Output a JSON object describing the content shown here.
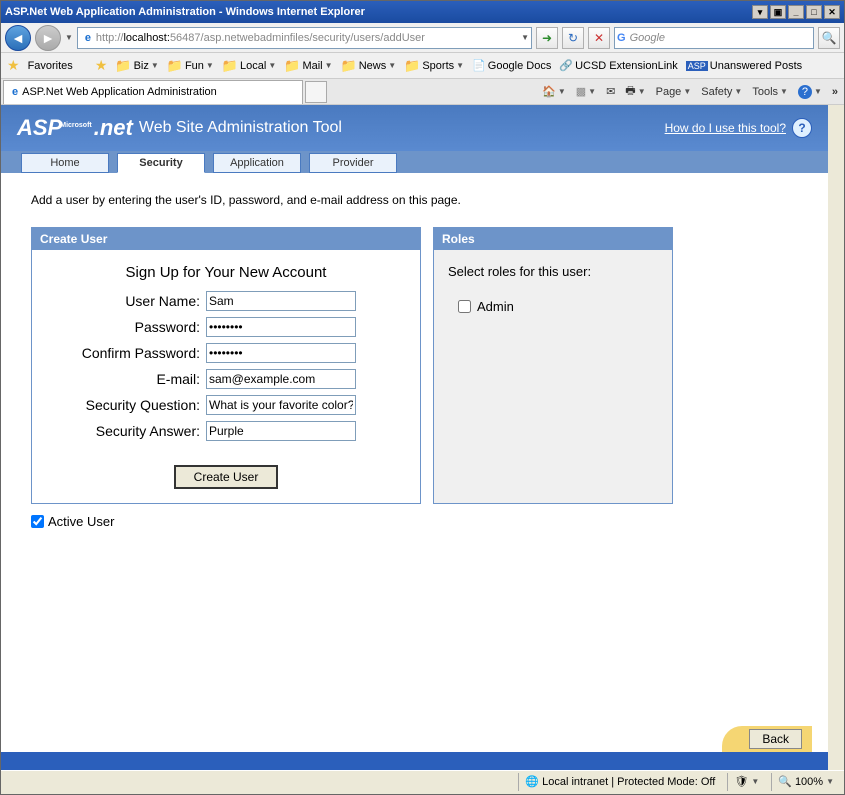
{
  "window": {
    "title": "ASP.Net Web Application Administration - Windows Internet Explorer"
  },
  "address": {
    "prefix": "http://",
    "host": "localhost:",
    "port": "56487",
    "path": "/asp.netwebadminfiles/security/users/addUser"
  },
  "search": {
    "placeholder": "Google"
  },
  "favorites": {
    "label": "Favorites",
    "items": [
      "Biz",
      "Fun",
      "Local",
      "Mail",
      "News",
      "Sports"
    ],
    "links": [
      "Google Docs",
      "UCSD ExtensionLink",
      "Unanswered Posts"
    ]
  },
  "pagetab": {
    "title": "ASP.Net Web Application Administration"
  },
  "commandbar": {
    "page": "Page",
    "safety": "Safety",
    "tools": "Tools"
  },
  "asp": {
    "logo_a": "ASP",
    "logo_b": ".net",
    "sublogo": "Web Site Administration Tool",
    "help": "How do I use this tool?",
    "tabs": [
      "Home",
      "Security",
      "Application",
      "Provider"
    ],
    "active_tab": "Security"
  },
  "page": {
    "instruction": "Add a user by entering the user's ID, password, and e-mail address on this page.",
    "create_user": {
      "heading": "Create User",
      "signup": "Sign Up for Your New Account",
      "labels": {
        "username": "User Name:",
        "password": "Password:",
        "confirm": "Confirm Password:",
        "email": "E-mail:",
        "question": "Security Question:",
        "answer": "Security Answer:"
      },
      "values": {
        "username": "Sam",
        "password": "••••••••",
        "confirm": "••••••••",
        "email": "sam@example.com",
        "question": "What is your favorite color?",
        "answer": "Purple"
      },
      "button": "Create User"
    },
    "roles": {
      "heading": "Roles",
      "instruction": "Select roles for this user:",
      "items": [
        "Admin"
      ]
    },
    "active_user": "Active User",
    "back": "Back"
  },
  "status": {
    "zone": "Local intranet | Protected Mode: Off",
    "zoom": "100%"
  }
}
